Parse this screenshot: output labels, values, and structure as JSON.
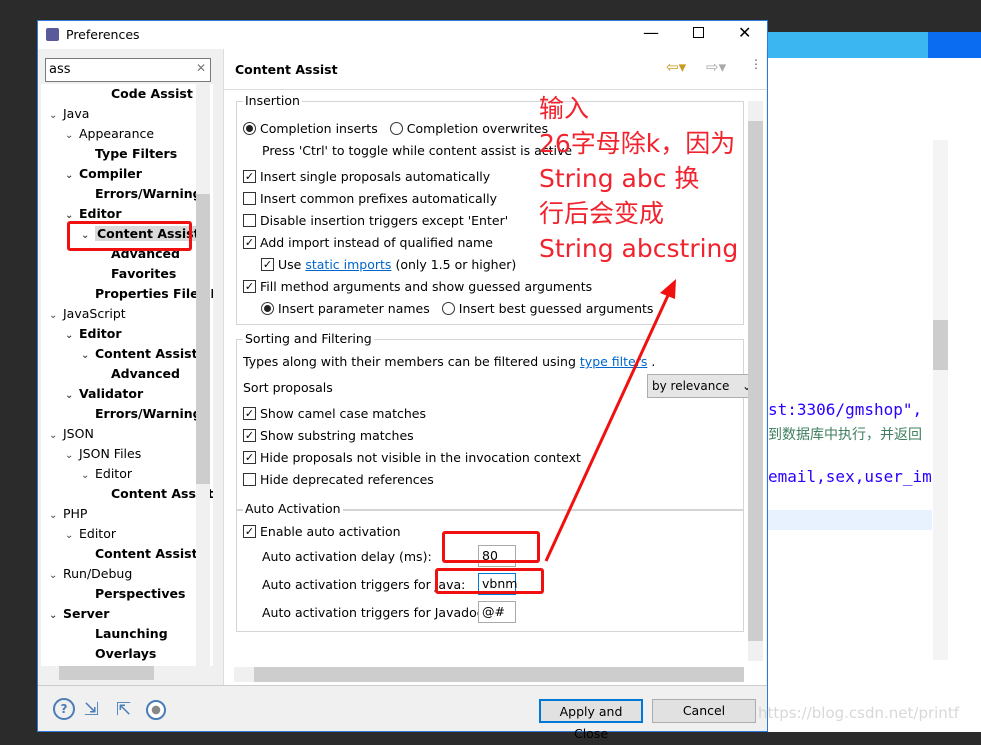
{
  "dialog": {
    "title": "Preferences"
  },
  "filter": {
    "value": "ass"
  },
  "tree": [
    {
      "label": "Code Assist",
      "level": 3,
      "bold": true,
      "chev": false
    },
    {
      "label": "Java",
      "level": 0,
      "bold": false,
      "chev": true
    },
    {
      "label": "Appearance",
      "level": 1,
      "bold": false,
      "chev": true
    },
    {
      "label": "Type Filters",
      "level": 2,
      "bold": true,
      "chev": false
    },
    {
      "label": "Compiler",
      "level": 1,
      "bold": true,
      "chev": true
    },
    {
      "label": "Errors/Warnings",
      "level": 2,
      "bold": true,
      "chev": false
    },
    {
      "label": "Editor",
      "level": 1,
      "bold": true,
      "chev": true
    },
    {
      "label": "Content Assist",
      "level": 2,
      "bold": true,
      "chev": true,
      "selected": true
    },
    {
      "label": "Advanced",
      "level": 3,
      "bold": true,
      "chev": false
    },
    {
      "label": "Favorites",
      "level": 3,
      "bold": true,
      "chev": false
    },
    {
      "label": "Properties Files Editor",
      "level": 1,
      "bold": true,
      "chev": false,
      "indent": 2
    },
    {
      "label": "JavaScript",
      "level": 0,
      "bold": false,
      "chev": true
    },
    {
      "label": "Editor",
      "level": 1,
      "bold": true,
      "chev": true
    },
    {
      "label": "Content Assist",
      "level": 2,
      "bold": true,
      "chev": true
    },
    {
      "label": "Advanced",
      "level": 3,
      "bold": true,
      "chev": false
    },
    {
      "label": "Validator",
      "level": 1,
      "bold": true,
      "chev": true
    },
    {
      "label": "Errors/Warnings",
      "level": 2,
      "bold": true,
      "chev": false
    },
    {
      "label": "JSON",
      "level": 0,
      "bold": false,
      "chev": true
    },
    {
      "label": "JSON Files",
      "level": 1,
      "bold": false,
      "chev": true
    },
    {
      "label": "Editor",
      "level": 2,
      "bold": false,
      "chev": true
    },
    {
      "label": "Content Assist",
      "level": 3,
      "bold": true,
      "chev": false
    },
    {
      "label": "PHP",
      "level": 0,
      "bold": false,
      "chev": true
    },
    {
      "label": "Editor",
      "level": 1,
      "bold": false,
      "chev": true
    },
    {
      "label": "Content Assist",
      "level": 2,
      "bold": true,
      "chev": false
    },
    {
      "label": "Run/Debug",
      "level": 0,
      "bold": false,
      "chev": true
    },
    {
      "label": "Perspectives",
      "level": 1,
      "bold": true,
      "chev": false,
      "indent": 2
    },
    {
      "label": "Server",
      "level": 0,
      "bold": true,
      "chev": true
    },
    {
      "label": "Launching",
      "level": 1,
      "bold": true,
      "chev": false,
      "indent": 2
    },
    {
      "label": "Overlays",
      "level": 1,
      "bold": true,
      "chev": false,
      "indent": 2
    }
  ],
  "page": {
    "title": "Content Assist"
  },
  "insertion": {
    "title": "Insertion",
    "radio1": "Completion inserts",
    "radio2": "Completion overwrites",
    "hint": "Press 'Ctrl' to toggle while content assist is active",
    "cb1": "Insert single proposals automatically",
    "cb2": "Insert common prefixes automatically",
    "cb3": "Disable insertion triggers except 'Enter'",
    "cb4": "Add import instead of qualified name",
    "cb5_pre": "Use",
    "cb5_link": "static imports",
    "cb5_post": "(only 1.5 or higher)",
    "cb6": "Fill method arguments and show guessed arguments",
    "radio3": "Insert parameter names",
    "radio4": "Insert best guessed arguments"
  },
  "sorting": {
    "title": "Sorting and Filtering",
    "desc": "Types along with their members can be filtered using",
    "link": "type filters",
    "sort_label": "Sort proposals",
    "sort_value": "by relevance",
    "cb1": "Show camel case matches",
    "cb2": "Show substring matches",
    "cb3": "Hide proposals not visible in the invocation context",
    "cb4": "Hide deprecated references"
  },
  "auto": {
    "title": "Auto Activation",
    "enable": "Enable auto activation",
    "delay_label": "Auto activation delay (ms):",
    "delay_value": "80",
    "java_label": "Auto activation triggers for Java:",
    "java_value": "vbnm",
    "javadoc_label": "Auto activation triggers for Javadoc:",
    "javadoc_value": "@#"
  },
  "buttons": {
    "apply_close": "Apply and Close",
    "cancel": "Cancel"
  },
  "annotation": "输入\n26字母除k，因为\nString abc 换\n行后会变成\nString abcstring",
  "background": {
    "code1": "st:3306/gmshop\",",
    "code2": "到数据库中执行，并返回",
    "code3": "email,sex,user_im",
    "watermark": "https://blog.csdn.net/printf"
  }
}
